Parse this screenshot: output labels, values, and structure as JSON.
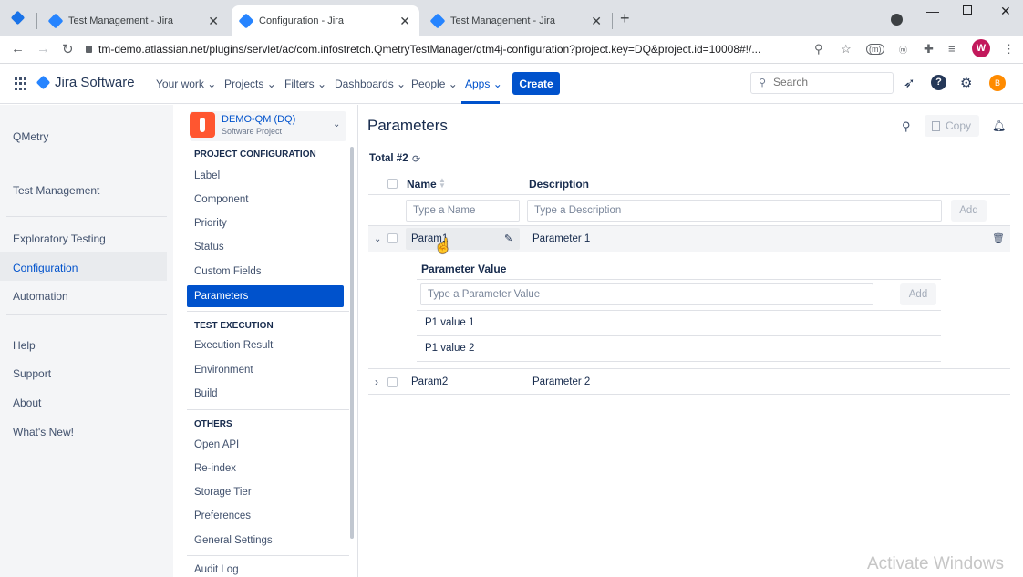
{
  "browser": {
    "tabs": [
      {
        "title": "Test Management - Jira"
      },
      {
        "title": "Configuration - Jira"
      },
      {
        "title": "Test Management - Jira"
      }
    ],
    "url": "tm-demo.atlassian.net/plugins/servlet/ac/com.infostretch.QmetryTestManager/qtm4j-configuration?project.key=DQ&project.id=10008#!/...",
    "profile_initial": "W"
  },
  "jira": {
    "product_name": "Jira Software",
    "nav": [
      "Your work",
      "Projects",
      "Filters",
      "Dashboards",
      "People",
      "Apps"
    ],
    "active_nav": "Apps",
    "create_label": "Create",
    "search_placeholder": "Search",
    "user_initial": "B",
    "accent_color": "#0052cc"
  },
  "left_sidebar": {
    "items": [
      "QMetry",
      "Test Management",
      "Exploratory Testing",
      "Configuration",
      "Automation",
      "Help",
      "Support",
      "About",
      "What's New!"
    ],
    "active": "Configuration"
  },
  "project_sidebar": {
    "project_name": "DEMO-QM (DQ)",
    "project_type": "Software Project",
    "sections": [
      {
        "title": "PROJECT CONFIGURATION",
        "items": [
          "Label",
          "Component",
          "Priority",
          "Status",
          "Custom Fields",
          "Parameters"
        ]
      },
      {
        "title": "TEST EXECUTION",
        "items": [
          "Execution Result",
          "Environment",
          "Build"
        ]
      },
      {
        "title": "OTHERS",
        "items": [
          "Open API",
          "Re-index",
          "Storage Tier",
          "Preferences",
          "General Settings",
          "Audit Log"
        ]
      }
    ],
    "active": "Parameters"
  },
  "main": {
    "title": "Parameters",
    "copy_label": "Copy",
    "total_label": "Total #2",
    "columns": {
      "name": "Name",
      "description": "Description"
    },
    "name_placeholder": "Type a Name",
    "description_placeholder": "Type a Description",
    "add_label": "Add",
    "rows": [
      {
        "name": "Param1",
        "description": "Parameter 1",
        "expanded": true
      },
      {
        "name": "Param2",
        "description": "Parameter 2",
        "expanded": false
      }
    ],
    "sub_table": {
      "title": "Parameter Value",
      "placeholder": "Type a Parameter Value",
      "add_label": "Add",
      "values": [
        "P1 value 1",
        "P1 value 2"
      ]
    }
  },
  "watermark": "Activate Windows"
}
